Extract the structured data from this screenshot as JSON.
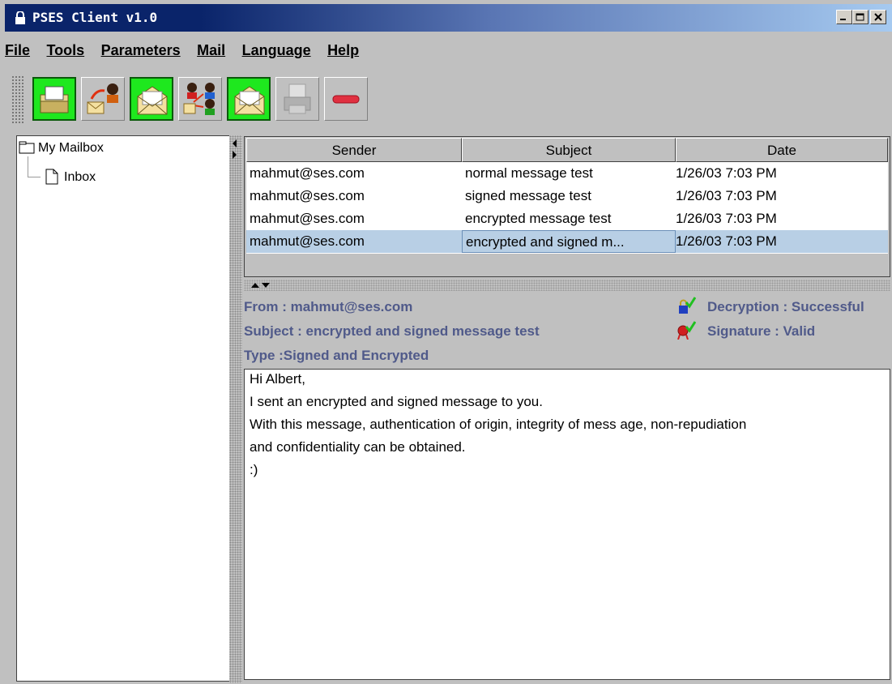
{
  "window": {
    "title": "PSES Client v1.0"
  },
  "menu": [
    "File",
    "Tools",
    "Parameters",
    "Mail",
    "Language",
    "Help"
  ],
  "toolbar": {
    "buttons": [
      {
        "icon": "open-mailbox-icon",
        "enabled": true
      },
      {
        "icon": "send-to-user-icon",
        "enabled": true
      },
      {
        "icon": "open-envelope-icon",
        "enabled": true
      },
      {
        "icon": "address-book-icon",
        "enabled": true
      },
      {
        "icon": "open-envelope-icon",
        "enabled": true
      },
      {
        "icon": "printer-icon",
        "enabled": false
      },
      {
        "icon": "delete-icon",
        "enabled": true
      }
    ]
  },
  "tree": {
    "root": "My Mailbox",
    "child": "Inbox"
  },
  "table": {
    "columns": [
      "Sender",
      "Subject",
      "Date"
    ],
    "rows": [
      {
        "sender": "mahmut@ses.com",
        "subject": "normal message test",
        "date": "1/26/03 7:03 PM",
        "selected": false
      },
      {
        "sender": "mahmut@ses.com",
        "subject": "signed message test",
        "date": "1/26/03 7:03 PM",
        "selected": false
      },
      {
        "sender": "mahmut@ses.com",
        "subject": "encrypted message test",
        "date": "1/26/03 7:03 PM",
        "selected": false
      },
      {
        "sender": "mahmut@ses.com",
        "subject": "encrypted and signed m...",
        "date": "1/26/03 7:03 PM",
        "selected": true
      }
    ]
  },
  "header": {
    "from": "From : mahmut@ses.com",
    "subject": "Subject : encrypted and signed message test",
    "type": "Type :Signed and Encrypted",
    "decryption": "Decryption : Successful",
    "signature": "Signature : Valid"
  },
  "body": {
    "lines": [
      "Hi Albert,",
      "I sent an encrypted and signed message to you.",
      "With this message, authentication of origin, integrity of mess age, non-repudiation",
      "and confidentiality can be obtained.",
      ":)"
    ]
  },
  "colors": {
    "titlebar": "#0a246a",
    "selection": "#b8cfe5",
    "header_text": "#505a8a",
    "toolbar_green": "#1ee81e"
  }
}
